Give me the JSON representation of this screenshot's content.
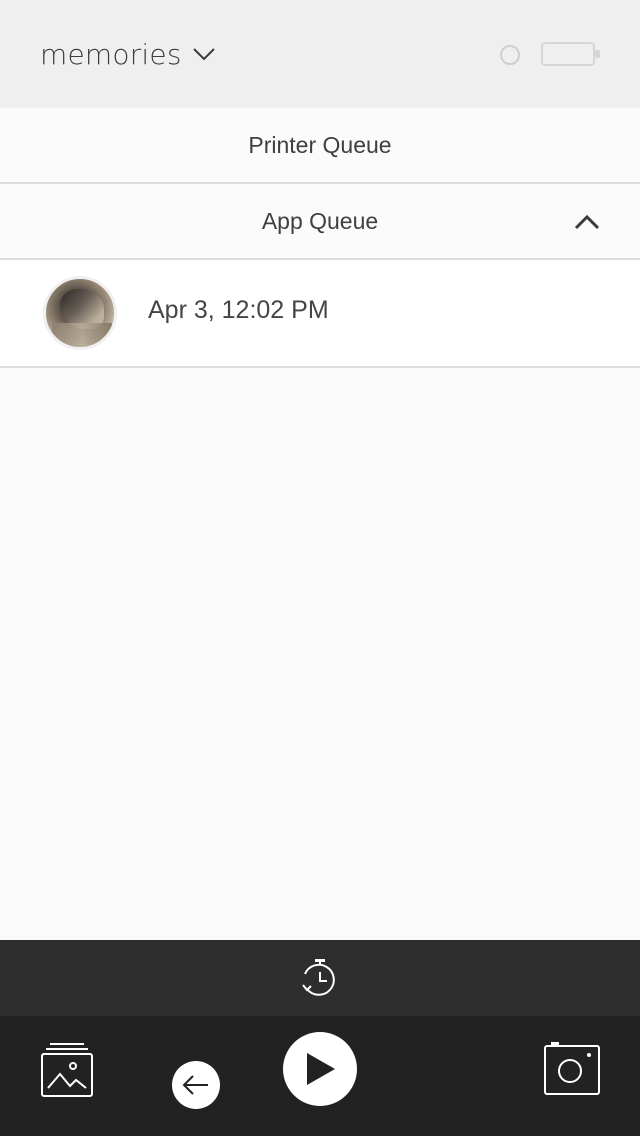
{
  "header": {
    "album_title": "memories",
    "dropdown_icon": "chevron-down-icon",
    "connection_icon": "connection-status-icon",
    "battery_icon": "battery-icon"
  },
  "queues": {
    "printer_queue_label": "Printer Queue",
    "app_queue_label": "App Queue",
    "app_queue_expanded": true,
    "app_queue_items": [
      {
        "date": "Apr 3, 12:02 PM",
        "thumbnail": "photo-thumbnail"
      }
    ]
  },
  "timer_bar": {
    "icon": "timer-icon"
  },
  "toolbar": {
    "gallery_icon": "gallery-icon",
    "back_icon": "back-arrow-icon",
    "play_icon": "play-icon",
    "camera_icon": "camera-icon"
  },
  "colors": {
    "header_bg": "#efefef",
    "list_bg": "#fafafa",
    "toolbar_bg": "#222222",
    "timer_bar_bg": "#2e2e2e",
    "text": "#3f3f3f"
  }
}
